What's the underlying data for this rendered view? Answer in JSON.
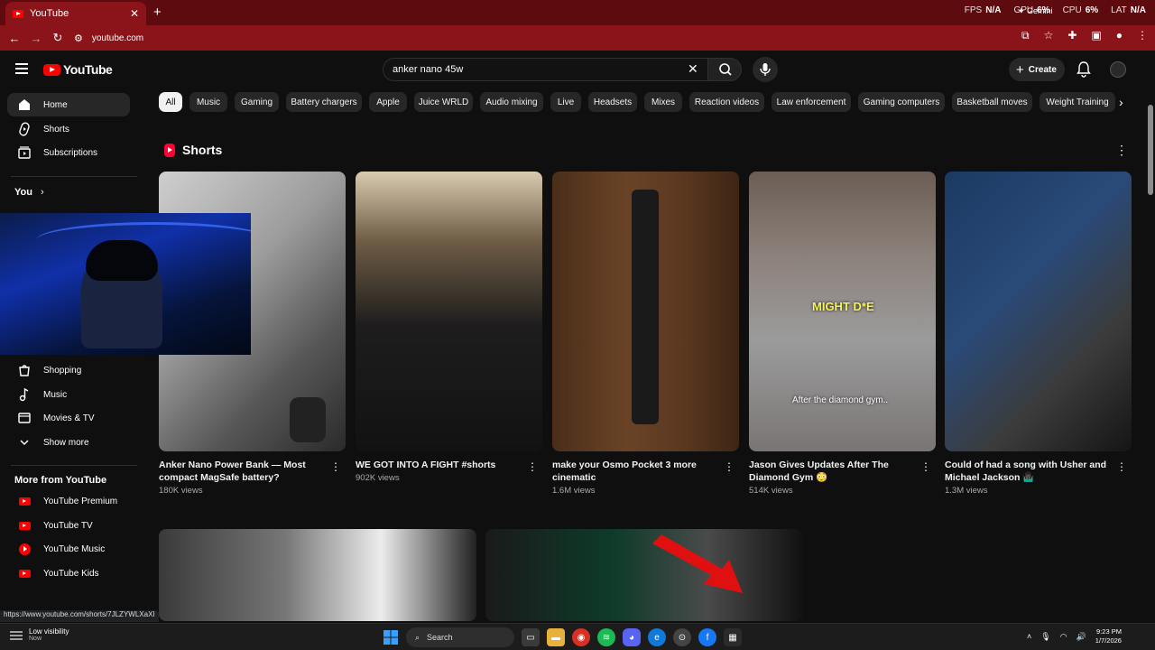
{
  "browser": {
    "tab_title": "YouTube",
    "url": "youtube.com",
    "new_tab_label": "+",
    "perf": [
      {
        "label": "FPS",
        "value": "N/A"
      },
      {
        "label": "GPU",
        "value": "6%"
      },
      {
        "label": "CPU",
        "value": "6%"
      },
      {
        "label": "LAT",
        "value": "N/A"
      }
    ],
    "gemini_label": "Gemini",
    "status_url": "https://www.youtube.com/shorts/7JLZYWLXaXI"
  },
  "header": {
    "logo_text": "YouTube",
    "search_value": "anker nano 45w",
    "create_label": "Create"
  },
  "sidebar": {
    "top_items": [
      {
        "label": "Home",
        "icon": "home-icon"
      },
      {
        "label": "Shorts",
        "icon": "shorts-icon"
      },
      {
        "label": "Subscriptions",
        "icon": "subscriptions-icon"
      }
    ],
    "you_label": "You",
    "explore_items": [
      {
        "label": "Shopping",
        "icon": "shopping-icon"
      },
      {
        "label": "Music",
        "icon": "music-icon"
      },
      {
        "label": "Movies & TV",
        "icon": "movies-icon"
      },
      {
        "label": "Show more",
        "icon": "chevron-down-icon"
      }
    ],
    "more_heading": "More from YouTube",
    "more_items": [
      {
        "label": "YouTube Premium",
        "icon": "youtube-premium-icon"
      },
      {
        "label": "YouTube TV",
        "icon": "youtube-tv-icon"
      },
      {
        "label": "YouTube Music",
        "icon": "youtube-music-icon"
      },
      {
        "label": "YouTube Kids",
        "icon": "youtube-kids-icon"
      }
    ]
  },
  "chips": [
    "All",
    "Music",
    "Gaming",
    "Battery chargers",
    "Apple",
    "Juice WRLD",
    "Audio mixing",
    "Live",
    "Headsets",
    "Mixes",
    "Reaction videos",
    "Law enforcement",
    "Gaming computers",
    "Basketball moves",
    "Weight Training"
  ],
  "shorts": {
    "heading": "Shorts",
    "items": [
      {
        "title": "Anker Nano Power Bank — Most compact MagSafe battery?",
        "views": "180K views"
      },
      {
        "title": "WE GOT INTO A FIGHT #shorts",
        "views": "902K views"
      },
      {
        "title": "make your Osmo Pocket 3 more cinematic",
        "views": "1.6M views"
      },
      {
        "title": "Jason Gives Updates After The Diamond Gym 😳",
        "views": "514K views",
        "overlay_top": "MIGHT D*E",
        "overlay_bottom": "After the diamond gym.."
      },
      {
        "title": "Could of had a song with Usher and Michael Jackson 🤷🏿‍♂️",
        "views": "1.3M views"
      }
    ]
  },
  "taskbar": {
    "weather_title": "Low visibility",
    "weather_sub": "Now",
    "search_label": "Search",
    "time": "9:23 PM",
    "date": "1/7/2026"
  }
}
